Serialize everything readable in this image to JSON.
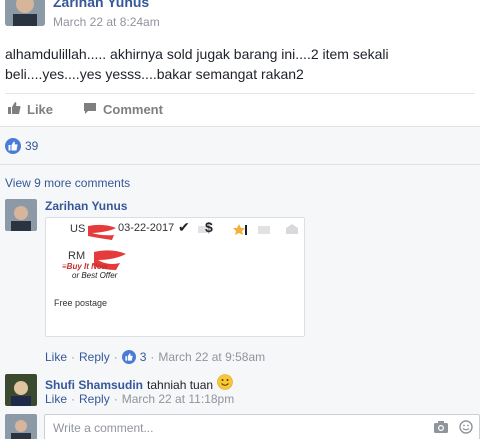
{
  "post": {
    "author": "Zarihan Yunus",
    "timestamp": "March 22 at 8:24am",
    "text": "alhamdulillah..... akhirnya sold jugak barang ini....2 item sekali beli....yes....yes yesss....bakar semangat rakan2",
    "like_label": "Like",
    "comment_label": "Comment",
    "reaction_count": "39"
  },
  "comments": {
    "view_more": "View 9 more comments",
    "items": [
      {
        "author": "Zarihan Yunus",
        "listing": {
          "date": "03-22-2017",
          "us_prefix": "US",
          "rm_prefix": "RM",
          "buy_now": "Buy It Now",
          "best_offer": "or Best Offer",
          "postage": "Free postage"
        },
        "like": "Like",
        "reply": "Reply",
        "reactions": "3",
        "time": "March 22 at 9:58am"
      },
      {
        "author": "Shufi Shamsudin",
        "text": "tahniah tuan",
        "like": "Like",
        "reply": "Reply",
        "time": "March 22 at 11:18pm"
      }
    ],
    "input_placeholder": "Write a comment..."
  },
  "colors": {
    "link": "#365899",
    "muted": "#90949c",
    "reaction": "#4a7bd6",
    "redaction": "#e53b3b"
  }
}
